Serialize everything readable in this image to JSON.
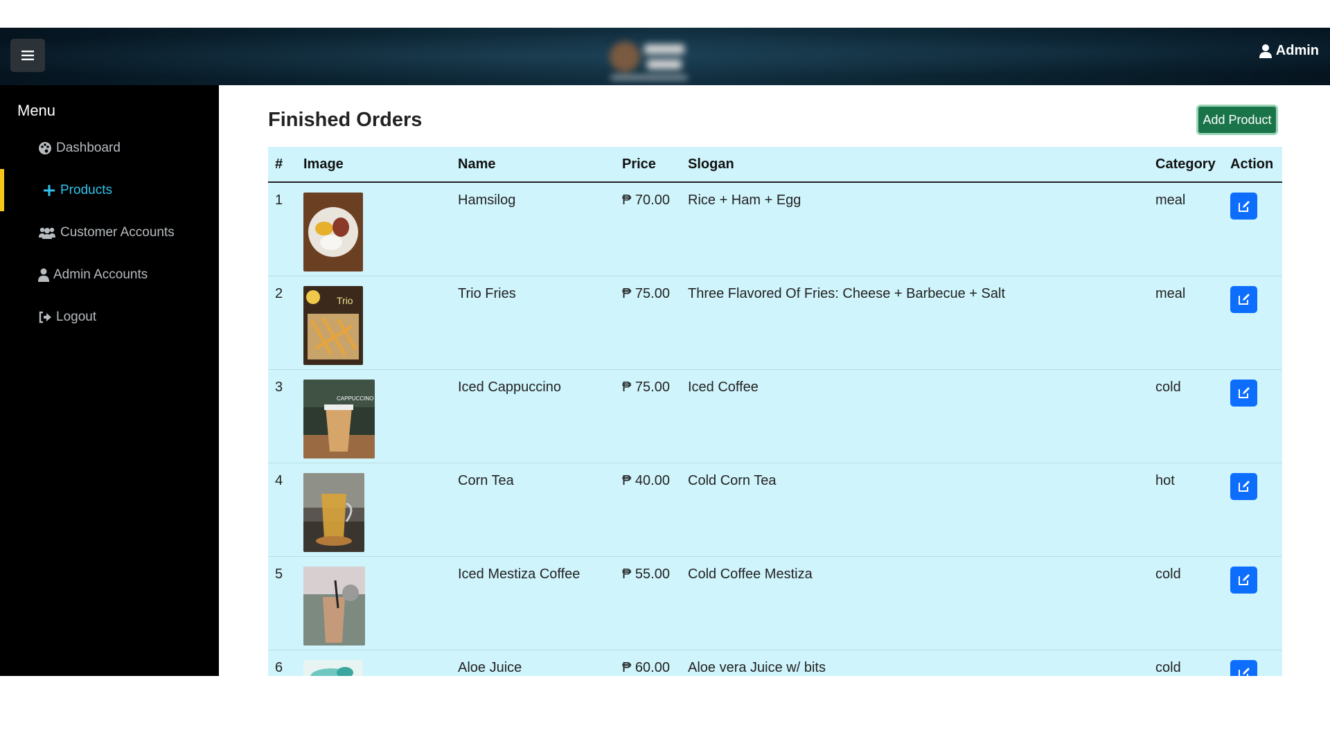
{
  "header": {
    "menu_toggle_icon": "hamburger-icon",
    "logo": "cafe-logo",
    "user_label": "Admin",
    "user_icon": "user-icon"
  },
  "sidebar": {
    "title": "Menu",
    "items": [
      {
        "label": "Dashboard",
        "icon": "palette-icon",
        "active": false
      },
      {
        "label": "Products",
        "icon": "plus-icon",
        "active": true
      },
      {
        "label": "Customer Accounts",
        "icon": "users-icon",
        "active": false
      },
      {
        "label": "Admin Accounts",
        "icon": "user-icon",
        "active": false
      },
      {
        "label": "Logout",
        "icon": "sign-out-icon",
        "active": false
      }
    ]
  },
  "main": {
    "title": "Finished Orders",
    "add_button": "Add Product",
    "table": {
      "headers": [
        "#",
        "Image",
        "Name",
        "Price",
        "Slogan",
        "Category",
        "Action"
      ],
      "rows": [
        {
          "num": "1",
          "name": "Hamsilog",
          "price": "₱ 70.00",
          "slogan": "Rice + Ham + Egg",
          "category": "meal"
        },
        {
          "num": "2",
          "name": "Trio Fries",
          "price": "₱ 75.00",
          "slogan": "Three Flavored Of Fries: Cheese + Barbecue + Salt",
          "category": "meal"
        },
        {
          "num": "3",
          "name": "Iced Cappuccino",
          "price": "₱ 75.00",
          "slogan": "Iced Coffee",
          "category": "cold"
        },
        {
          "num": "4",
          "name": "Corn Tea",
          "price": "₱ 40.00",
          "slogan": "Cold Corn Tea",
          "category": "hot"
        },
        {
          "num": "5",
          "name": "Iced Mestiza Coffee",
          "price": "₱ 55.00",
          "slogan": "Cold Coffee Mestiza",
          "category": "cold"
        },
        {
          "num": "6",
          "name": "Aloe Juice",
          "price": "₱ 60.00",
          "slogan": "Aloe vera Juice w/ bits",
          "category": "cold"
        }
      ]
    }
  },
  "colors": {
    "sidebar_bg": "#000000",
    "active_accent": "#f5c518",
    "active_text": "#2ec4ee",
    "table_bg": "#cff4fc",
    "add_button_bg": "#1a7449",
    "edit_button_bg": "#0d6efd"
  }
}
